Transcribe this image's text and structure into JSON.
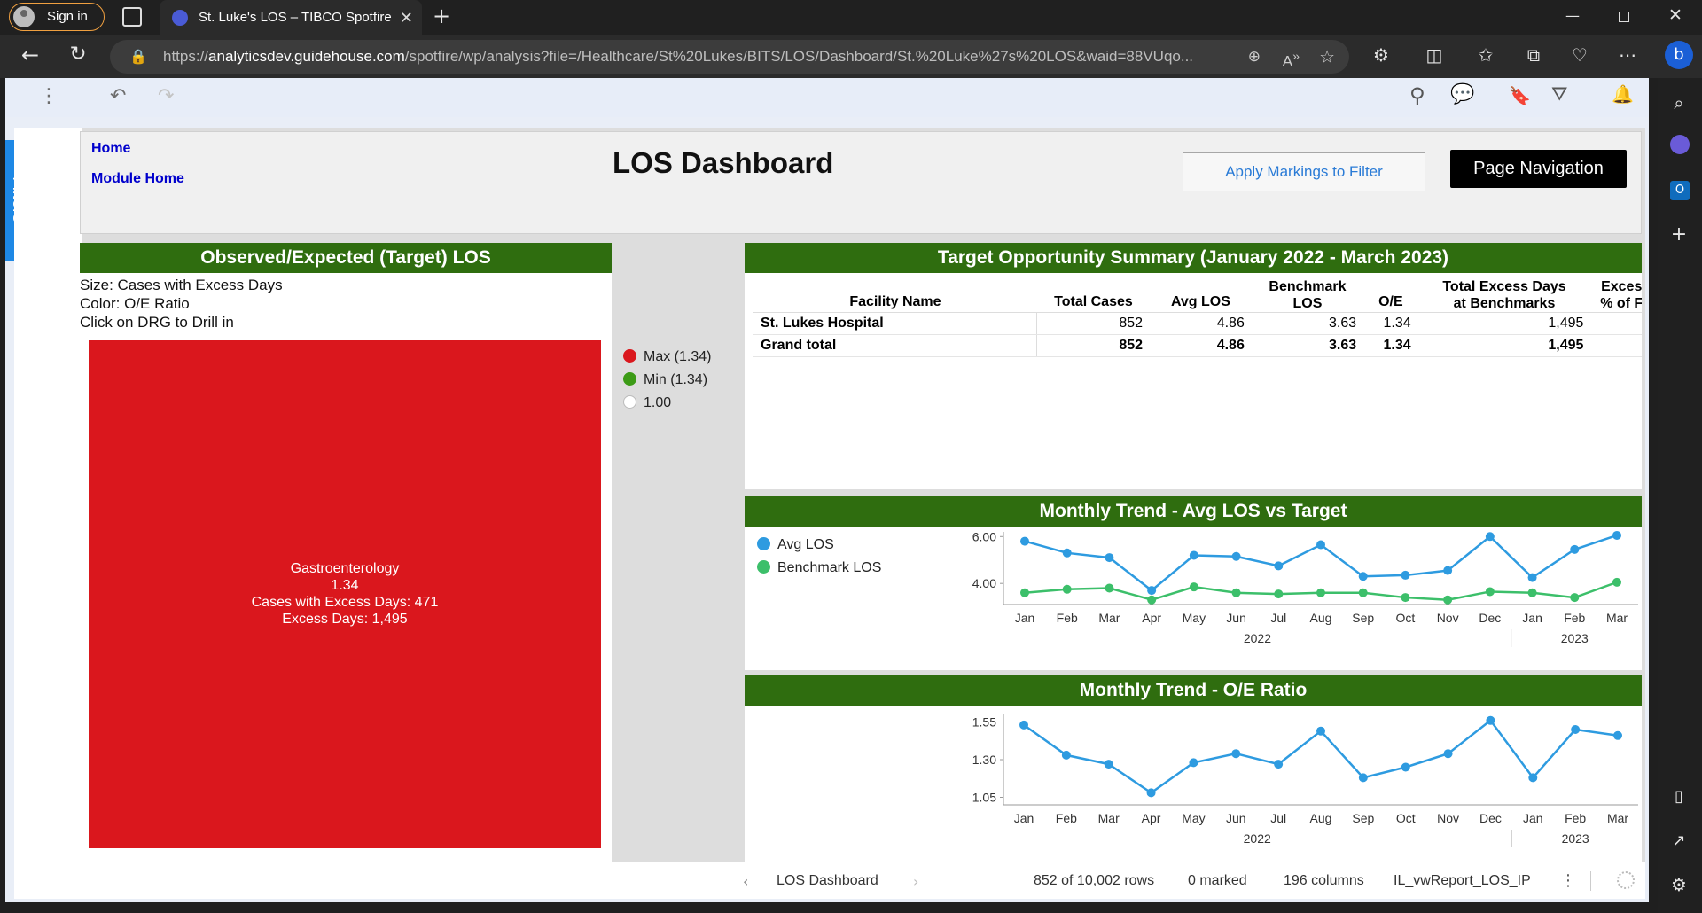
{
  "browser": {
    "sign_in_label": "Sign in",
    "tab_title": "St. Luke's LOS – TIBCO Spotfire",
    "url_prefix": "https://",
    "url_host": "analyticsdev.guidehouse.com",
    "url_path": "/spotfire/wp/analysis?file=/Healthcare/St%20Lukes/BITS/LOS/Dashboard/St.%20Luke%27s%20LOS&waid=88VUqo..."
  },
  "filters_label": "Filters",
  "header": {
    "home_link": "Home",
    "module_home_link": "Module Home",
    "title": "LOS Dashboard",
    "apply_markings_button": "Apply Markings to Filter",
    "page_navigation_button": "Page Navigation"
  },
  "treemap_panel": {
    "title": "Observed/Expected (Target) LOS",
    "description": [
      "Size: Cases with Excess Days",
      "Color: O/E Ratio",
      "Click on DRG to Drill in"
    ],
    "legend": [
      {
        "label": "Max (1.34)",
        "color": "#da171d"
      },
      {
        "label": "Min (1.34)",
        "color": "#3c9b16"
      },
      {
        "label": "1.00",
        "color": "#ffffff"
      }
    ],
    "tile": {
      "name": "Gastroenterology",
      "ratio": "1.34",
      "cases": "Cases with Excess Days: 471",
      "excess": "Excess Days: 1,495",
      "color": "#da171d"
    }
  },
  "summary_panel": {
    "title": "Target Opportunity Summary (January 2022 - March 2023)",
    "columns": [
      "Facility Name",
      "Total Cases",
      "Avg LOS",
      "Benchmark LOS",
      "O/E",
      "Total Excess Days at Benchmarks",
      "Exces % of F"
    ],
    "rows": [
      [
        "St. Lukes Hospital",
        "852",
        "4.86",
        "3.63",
        "1.34",
        "1,495",
        ""
      ],
      [
        "Grand total",
        "852",
        "4.86",
        "3.63",
        "1.34",
        "1,495",
        ""
      ]
    ]
  },
  "chart_data": [
    {
      "type": "line",
      "title": "Monthly Trend - Avg LOS vs Target",
      "x": [
        "Jan 2022",
        "Feb 2022",
        "Mar 2022",
        "Apr 2022",
        "May 2022",
        "Jun 2022",
        "Jul 2022",
        "Aug 2022",
        "Sep 2022",
        "Oct 2022",
        "Nov 2022",
        "Dec 2022",
        "Jan 2023",
        "Feb 2023",
        "Mar 2023"
      ],
      "x_tick_labels": [
        "Jan",
        "Feb",
        "Mar",
        "Apr",
        "May",
        "Jun",
        "Jul",
        "Aug",
        "Sep",
        "Oct",
        "Nov",
        "Dec",
        "Jan",
        "Feb",
        "Mar"
      ],
      "x_group_labels": [
        "2022",
        "2023"
      ],
      "y_ticks": [
        "4.00",
        "6.00"
      ],
      "ylim": [
        3.1,
        6.2
      ],
      "grid": false,
      "legend_position": "left",
      "series": [
        {
          "name": "Avg LOS",
          "color": "#2e9be0",
          "values": [
            5.8,
            5.3,
            5.1,
            3.7,
            5.2,
            5.15,
            4.75,
            5.65,
            4.3,
            4.35,
            4.55,
            6.0,
            4.25,
            5.45,
            6.05
          ]
        },
        {
          "name": "Benchmark LOS",
          "color": "#3cbf6a",
          "values": [
            3.6,
            3.75,
            3.8,
            3.3,
            3.85,
            3.6,
            3.55,
            3.6,
            3.6,
            3.4,
            3.3,
            3.65,
            3.6,
            3.4,
            4.05
          ]
        }
      ]
    },
    {
      "type": "line",
      "title": "Monthly Trend - O/E Ratio",
      "x": [
        "Jan 2022",
        "Feb 2022",
        "Mar 2022",
        "Apr 2022",
        "May 2022",
        "Jun 2022",
        "Jul 2022",
        "Aug 2022",
        "Sep 2022",
        "Oct 2022",
        "Nov 2022",
        "Dec 2022",
        "Jan 2023",
        "Feb 2023",
        "Mar 2023"
      ],
      "x_tick_labels": [
        "Jan",
        "Feb",
        "Mar",
        "Apr",
        "May",
        "Jun",
        "Jul",
        "Aug",
        "Sep",
        "Oct",
        "Nov",
        "Dec",
        "Jan",
        "Feb",
        "Mar"
      ],
      "x_group_labels": [
        "2022",
        "2023"
      ],
      "y_ticks": [
        "1.05",
        "1.30",
        "1.55"
      ],
      "ylim": [
        1.0,
        1.6
      ],
      "grid": false,
      "series": [
        {
          "name": "",
          "color": "#2e9be0",
          "values": [
            1.53,
            1.33,
            1.27,
            1.08,
            1.28,
            1.34,
            1.27,
            1.49,
            1.18,
            1.25,
            1.34,
            1.56,
            1.18,
            1.5,
            1.46
          ]
        }
      ]
    }
  ],
  "status_bar": {
    "page_name": "LOS Dashboard",
    "rows": "852 of 10,002 rows",
    "marked": "0 marked",
    "columns": "196 columns",
    "table": "IL_vwReport_LOS_IP"
  }
}
